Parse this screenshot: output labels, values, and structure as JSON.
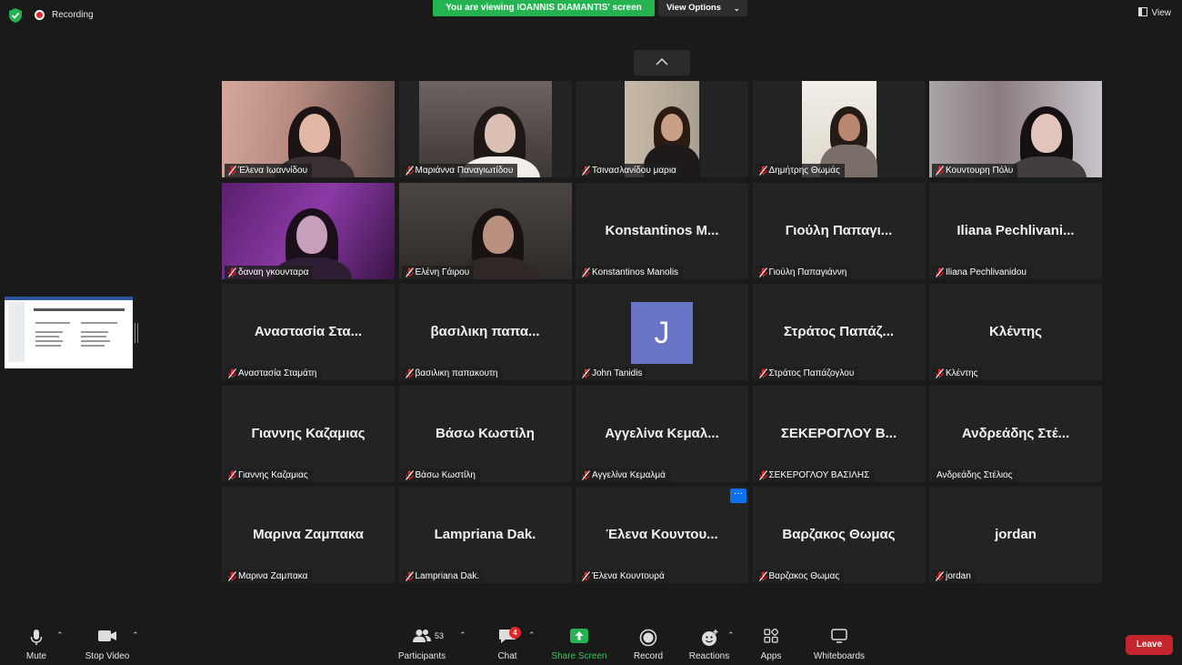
{
  "topbar": {
    "recording_label": "Recording",
    "viewing_banner": "You are viewing IOANNIS DIAMANTIS' screen",
    "view_options_label": "View Options",
    "view_label": "View"
  },
  "participants": [
    {
      "name": "Έλενα Ιωαννίδου",
      "has_video": true
    },
    {
      "name": "Μαριάννα Παναγιωτίδου",
      "has_video": true
    },
    {
      "name": "Τσινασλανίδου μαρια",
      "has_video": true
    },
    {
      "name": "Δημήτρης Θωμάς",
      "has_video": true
    },
    {
      "name": "Κουντουρη Πόλυ",
      "has_video": true
    },
    {
      "name": "δαναη γκουνταρα",
      "has_video": true
    },
    {
      "name": "Ελένη Γάιρου",
      "has_video": true
    },
    {
      "name": "Konstantinos Manolis",
      "display": "Konstantinos M...",
      "has_video": false
    },
    {
      "name": "Γιούλη Παπαγιάννη",
      "display": "Γιούλη Παπαγι...",
      "has_video": false
    },
    {
      "name": "Iliana Pechlivanidou",
      "display": "Iliana Pechlivani...",
      "has_video": false
    },
    {
      "name": "Αναστασία Σταμάτη",
      "display": "Αναστασία Στα...",
      "has_video": false
    },
    {
      "name": "βασιλικη παπακουτη",
      "display": "βασιλικη παπα...",
      "has_video": false
    },
    {
      "name": "John Tanidis",
      "avatar": "J",
      "has_video": false
    },
    {
      "name": "Στράτος Παπάζογλου",
      "display": "Στράτος Παπάζ...",
      "has_video": false
    },
    {
      "name": "Κλέντης",
      "display": "Κλέντης",
      "has_video": false
    },
    {
      "name": "Γιαννης Καζαμιας",
      "display": "Γιαννης Καζαμιας",
      "has_video": false
    },
    {
      "name": "Βάσω Κωστίλη",
      "display": "Βάσω Κωστίλη",
      "has_video": false
    },
    {
      "name": "Αγγελίνα Κεμαλμά",
      "display": "Αγγελίνα Κεμαλ...",
      "has_video": false
    },
    {
      "name": "ΣΕΚΕΡΟΓΛΟΥ ΒΑΣΙΛΗΣ",
      "display": "ΣΕΚΕΡΟΓΛΟΥ Β...",
      "has_video": false
    },
    {
      "name": "Ανδρεάδης Στέλιος",
      "display": "Ανδρεάδης Στέ...",
      "has_video": false,
      "muted": false
    },
    {
      "name": "Μαρινα Ζαμπακα",
      "display": "Μαρινα Ζαμπακα",
      "has_video": false
    },
    {
      "name": "Lampriana Dak.",
      "display": "Lampriana Dak.",
      "has_video": false
    },
    {
      "name": "Έλενα Κουντουρά",
      "display": "Έλενα Κουντου...",
      "has_video": false,
      "more_button": "···"
    },
    {
      "name": "Βαρζακος Θωμας",
      "display": "Βαρζακος Θωμας",
      "has_video": false
    },
    {
      "name": "jordan",
      "display": "jordan",
      "has_video": false
    }
  ],
  "toolbar": {
    "mute_label": "Mute",
    "stop_video_label": "Stop Video",
    "participants_label": "Participants",
    "participants_count": "53",
    "chat_label": "Chat",
    "chat_badge": "4",
    "share_screen_label": "Share Screen",
    "record_label": "Record",
    "reactions_label": "Reactions",
    "apps_label": "Apps",
    "whiteboards_label": "Whiteboards",
    "leave_label": "Leave"
  },
  "colors": {
    "banner_green": "#24b350",
    "leave_red": "#c4252d",
    "mute_red": "#e02828",
    "avatar_purple": "#6874c4"
  }
}
